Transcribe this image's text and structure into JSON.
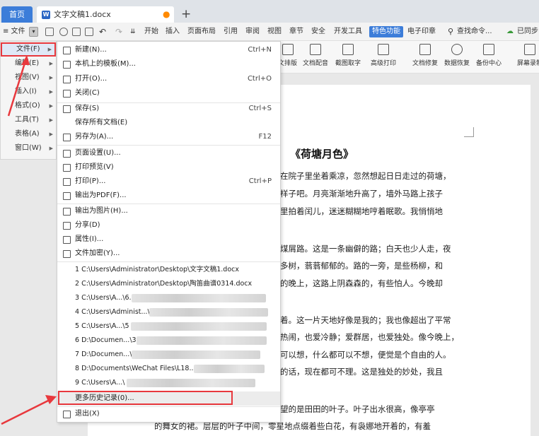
{
  "tabs": {
    "home": "首页",
    "document": "文字文稿1.docx",
    "new_tab": "+"
  },
  "menubar": {
    "file": "≡ 文件",
    "items": [
      "开始",
      "插入",
      "页面布局",
      "引用",
      "审阅",
      "视图",
      "章节",
      "安全",
      "开发工具",
      "特色功能",
      "电子印章"
    ],
    "search": "查找命令...",
    "sync": "已同步"
  },
  "ribbon": {
    "items": [
      "文排版",
      "文档配音",
      "截图取字",
      "高级打印",
      "文档修复",
      "数据恢复",
      "备份中心",
      "屏幕录制"
    ]
  },
  "main_menu": {
    "items": [
      {
        "label": "文件(F)"
      },
      {
        "label": "编辑(E)"
      },
      {
        "label": "视图(V)"
      },
      {
        "label": "插入(I)"
      },
      {
        "label": "格式(O)"
      },
      {
        "label": "工具(T)"
      },
      {
        "label": "表格(A)"
      },
      {
        "label": "窗口(W)"
      }
    ]
  },
  "file_menu": {
    "items": [
      {
        "label": "新建(N)...",
        "shortcut": "Ctrl+N"
      },
      {
        "label": "本机上的模板(M)...",
        "shortcut": ""
      },
      {
        "label": "打开(O)...",
        "shortcut": "Ctrl+O"
      },
      {
        "label": "关闭(C)",
        "shortcut": ""
      },
      {
        "label": "保存(S)",
        "shortcut": "Ctrl+S"
      },
      {
        "label": "保存所有文档(E)",
        "shortcut": ""
      },
      {
        "label": "另存为(A)...",
        "shortcut": "F12"
      },
      {
        "label": "页面设置(U)...",
        "shortcut": ""
      },
      {
        "label": "打印预览(V)",
        "shortcut": ""
      },
      {
        "label": "打印(P)...",
        "shortcut": "Ctrl+P"
      },
      {
        "label": "输出为PDF(F)...",
        "shortcut": ""
      },
      {
        "label": "输出为图片(H)...",
        "shortcut": ""
      },
      {
        "label": "分享(D)",
        "shortcut": ""
      },
      {
        "label": "属性(I)...",
        "shortcut": ""
      },
      {
        "label": "文件加密(Y)...",
        "shortcut": ""
      }
    ],
    "recent": [
      "1 C:\\Users\\Administrator\\Desktop\\文字文稿1.docx",
      "2 C:\\Users\\Administrator\\Desktop\\陶笛曲谱0314.docx",
      "3 C:\\Users\\A...\\6.",
      "4 C:\\Users\\Administ...\\",
      "5 C:\\Users\\A...\\5",
      "6 D:\\Documen...\\3.",
      "7 D:\\Documen...\\",
      "8 D:\\Documents\\WeChat Files\\L18...\\",
      "9 C:\\Users\\A...\\"
    ],
    "more_history": "更多历史记录(0)...",
    "exit": "退出(X)"
  },
  "document": {
    "title": "《荷塘月色》",
    "lines": [
      "在院子里坐着乘凉，忽然想起日日走过的荷塘，",
      "样子吧。月亮渐渐地升高了，墙外马路上孩子",
      "里拍着闰儿，迷迷糊糊地哼着眠歌。我悄悄地",
      "煤屑路。这是一条幽僻的路；白天也少人走，夜",
      "多树，蓊蓊郁郁的。路的一旁，是些杨柳，和",
      "的晚上，这路上阴森森的，有些怕人。今晚却",
      "着。这一片天地好像是我的；我也像超出了平常",
      "热闹，也爱冷静；爱群居，也爱独处。像今晚上，",
      "可以想，什么都可以不想，便觉是个自由的人。",
      "的话，现在都可不理。这是独处的妙处，我且",
      "望的是田田的叶子。叶子出水很高，像亭亭",
      "的舞女的裙。层层的叶子中间，零星地点缀着些白花，有袅娜地开着的，有羞"
    ]
  }
}
